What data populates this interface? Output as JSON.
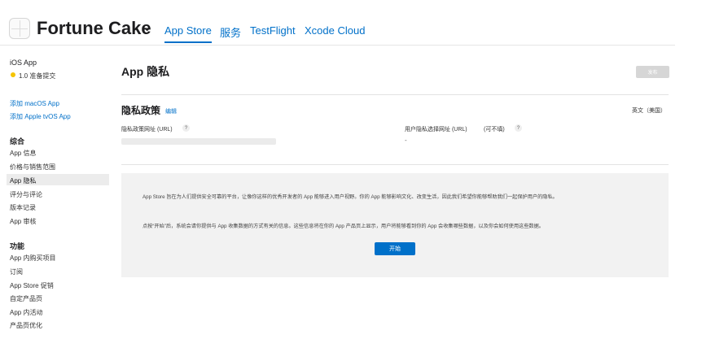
{
  "header": {
    "app_name": "Fortune Cake",
    "tabs": [
      {
        "label": "App Store",
        "active": true
      },
      {
        "label": "服务",
        "active": false
      },
      {
        "label": "TestFlight",
        "active": false
      },
      {
        "label": "Xcode Cloud",
        "active": false
      }
    ]
  },
  "sidebar": {
    "platform": "iOS App",
    "version_status": "1.0 准备提交",
    "add_links": [
      "添加 macOS App",
      "添加 Apple tvOS App"
    ],
    "general": {
      "title": "综合",
      "items": [
        "App 信息",
        "价格与销售范围",
        "App 隐私",
        "评分与评论",
        "版本记录",
        "App 审核"
      ],
      "active_item": "App 隐私"
    },
    "features": {
      "title": "功能",
      "items": [
        "App 内购买项目",
        "订阅",
        "App Store 促销",
        "自定产品页",
        "App 内活动",
        "产品页优化"
      ]
    }
  },
  "main": {
    "page_title": "App 隐私",
    "publish_label": "发布",
    "policy": {
      "title": "隐私政策",
      "edit_label": "编辑",
      "language": "英文（美国）",
      "policy_url_label": "隐私政策网址 (URL)",
      "user_choice_label": "用户隐私选择网址 (URL)",
      "user_choice_optional": "(可不填)",
      "user_choice_value": "-"
    },
    "intro": {
      "paragraph1": "App Store 旨在为人们提供安全可靠的平台，让像你这样的优秀开发者的 App 能够进入用户视野。你的 App 能够影响文化、改变生活，因此我们希望你能够帮助我们一起保护用户的隐私。",
      "paragraph2": "点按“开始”后，系统会请你提供与 App 收集数据的方式有关的信息。这些信息将在你的 App 产品页上显示，用户将能够看到你的 App 会收集哪些数据，以及你会如何使用这些数据。",
      "start_label": "开始"
    }
  },
  "colors": {
    "accent": "#0070c9",
    "status_dot": "#f5c400",
    "disabled_button": "#d6d6d6",
    "intro_background": "#f2f2f2"
  },
  "icons": {
    "app_icon": "app-placeholder-icon",
    "chevron": "chevron-down-icon",
    "status": "status-dot-icon",
    "help": "help-icon"
  }
}
